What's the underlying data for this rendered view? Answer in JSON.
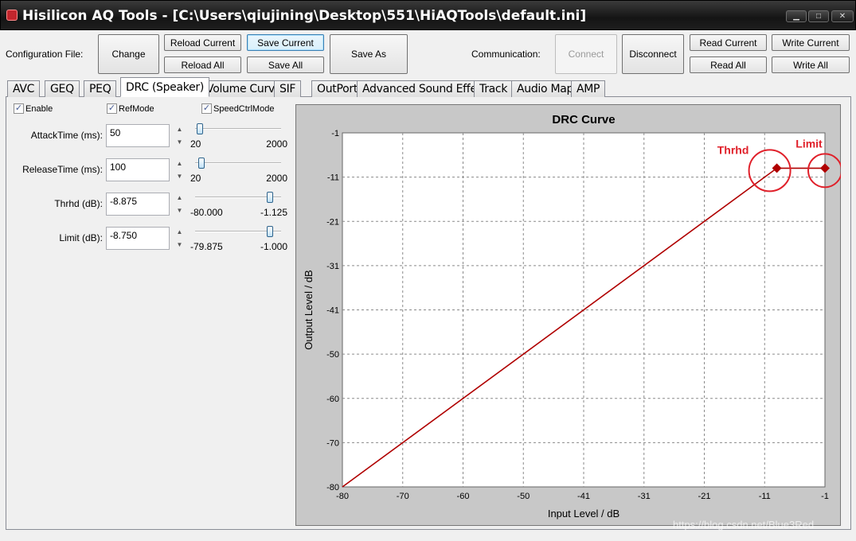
{
  "window": {
    "title": "Hisilicon AQ Tools - [C:\\Users\\qiujining\\Desktop\\551\\HiAQTools\\default.ini]",
    "controls": {
      "minimize": "▁",
      "maximize": "□",
      "close": "✕"
    }
  },
  "toolbar": {
    "config_label": "Configuration File:",
    "change": "Change",
    "reload_current": "Reload Current",
    "save_current": "Save Current",
    "reload_all": "Reload All",
    "save_all": "Save All",
    "save_as": "Save As",
    "comm_label": "Communication:",
    "connect": "Connect",
    "disconnect": "Disconnect",
    "read_current": "Read Current",
    "write_current": "Write Current",
    "read_all": "Read All",
    "write_all": "Write All"
  },
  "tabs": [
    "AVC",
    "GEQ",
    "PEQ",
    "DRC (Speaker)",
    "Volume Curve",
    "SIF",
    "OutPort",
    "Advanced Sound Effect",
    "Track",
    "Audio Map",
    "AMP"
  ],
  "active_tab": "DRC (Speaker)",
  "checkboxes": [
    {
      "label": "Enable",
      "checked": true
    },
    {
      "label": "RefMode",
      "checked": true
    },
    {
      "label": "SpeedCtrlMode",
      "checked": true
    }
  ],
  "params": [
    {
      "label": "AttackTime (ms):",
      "value": "50",
      "min": "20",
      "max": "2000",
      "level": 0.02
    },
    {
      "label": "ReleaseTime (ms):",
      "value": "100",
      "min": "20",
      "max": "2000",
      "level": 0.04
    },
    {
      "label": "Thrhd (dB):",
      "value": "-8.875",
      "min": "-80.000",
      "max": "-1.125",
      "level": 0.9
    },
    {
      "label": "Limit (dB):",
      "value": "-8.750",
      "min": "-79.875",
      "max": "-1.000",
      "level": 0.9
    }
  ],
  "spin": {
    "up": "▲",
    "down": "▼"
  },
  "chart_data": {
    "type": "line",
    "title": "DRC Curve",
    "xlabel": "Input Level / dB",
    "ylabel": "Output Level / dB",
    "xlim": [
      -80,
      -1
    ],
    "ylim": [
      -80,
      -1
    ],
    "x_ticks": [
      "-80",
      "-70",
      "-60",
      "-50",
      "-41",
      "-31",
      "-21",
      "-11",
      "-1"
    ],
    "y_ticks": [
      "-1",
      "-11",
      "-21",
      "-31",
      "-41",
      "-50",
      "-60",
      "-70",
      "-80"
    ],
    "grid": true,
    "series": [
      {
        "x": [
          -80,
          -8.875,
          -1
        ],
        "y": [
          -80,
          -8.875,
          -8.875
        ],
        "color": "#b00000"
      }
    ],
    "markers": [
      {
        "label": "Thrhd",
        "x": -8.875,
        "y": -8.875
      },
      {
        "label": "Limit",
        "x": -1,
        "y": -8.875
      }
    ],
    "annotation_color": "#e0202a"
  },
  "watermark": "https://blog.csdn.net/Blue3Red"
}
